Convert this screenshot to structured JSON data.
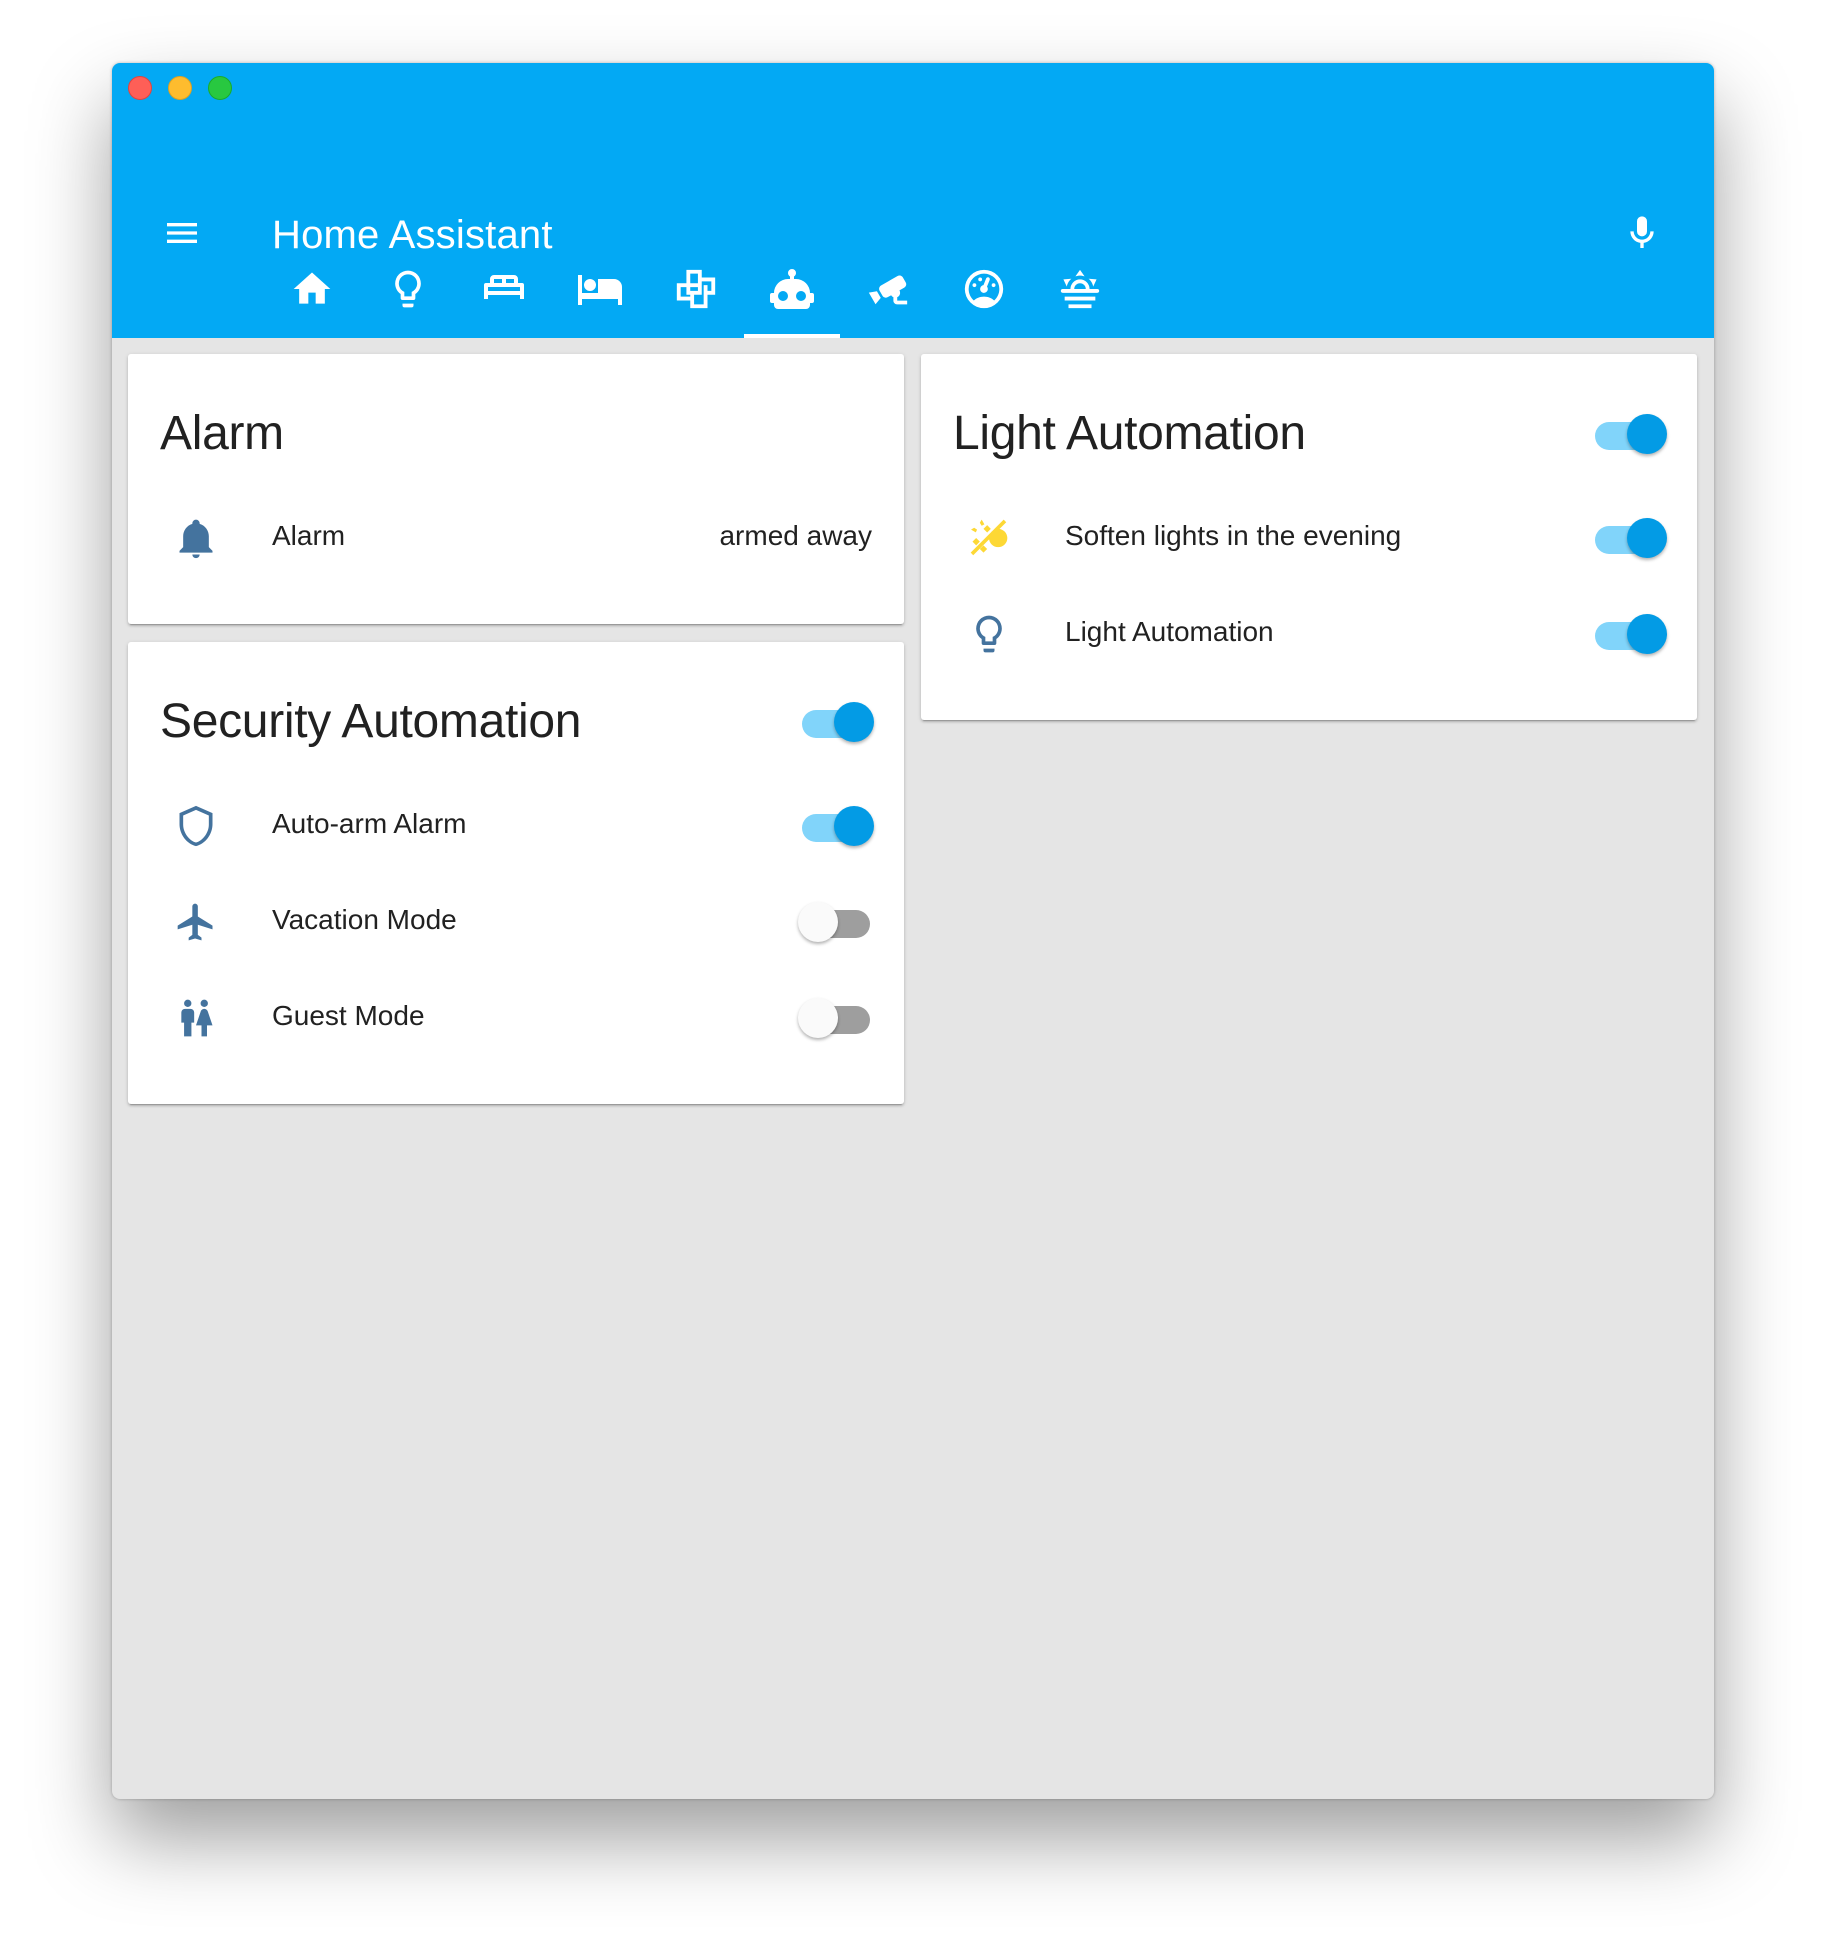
{
  "window": {
    "title": "Home Assistant"
  },
  "header": {
    "menu_icon": "hamburger-menu-icon",
    "mic_icon": "microphone-icon"
  },
  "tabs": [
    {
      "icon": "home-icon",
      "active": false
    },
    {
      "icon": "lightbulb-icon",
      "active": false
    },
    {
      "icon": "sofa-icon",
      "active": false
    },
    {
      "icon": "bed-icon",
      "active": false
    },
    {
      "icon": "floor-plan-icon",
      "active": false
    },
    {
      "icon": "robot-icon",
      "active": true
    },
    {
      "icon": "cctv-icon",
      "active": false
    },
    {
      "icon": "gauge-icon",
      "active": false
    },
    {
      "icon": "weather-sunset-icon",
      "active": false
    }
  ],
  "alarm_card": {
    "title": "Alarm",
    "row": {
      "icon": "bell-icon",
      "label": "Alarm",
      "state": "armed away"
    }
  },
  "security_card": {
    "title": "Security Automation",
    "toggle_on": true,
    "rows": [
      {
        "icon": "shield-outline-icon",
        "label": "Auto-arm Alarm",
        "toggle_on": true
      },
      {
        "icon": "airplane-icon",
        "label": "Vacation Mode",
        "toggle_on": false
      },
      {
        "icon": "human-male-female-icon",
        "label": "Guest Mode",
        "toggle_on": false
      }
    ]
  },
  "light_card": {
    "title": "Light Automation",
    "toggle_on": true,
    "rows": [
      {
        "icon": "weather-sunset-yellow-icon",
        "label": "Soften lights in the evening",
        "toggle_on": true
      },
      {
        "icon": "lightbulb-outline-icon",
        "label": "Light Automation",
        "toggle_on": true
      }
    ]
  },
  "colors": {
    "header": "#03a9f4",
    "icon_blue": "#44739e",
    "icon_yellow": "#fdd835",
    "toggle_on_knob": "#039be5",
    "toggle_on_track": "#81d4fa",
    "background": "#e5e5e5"
  }
}
